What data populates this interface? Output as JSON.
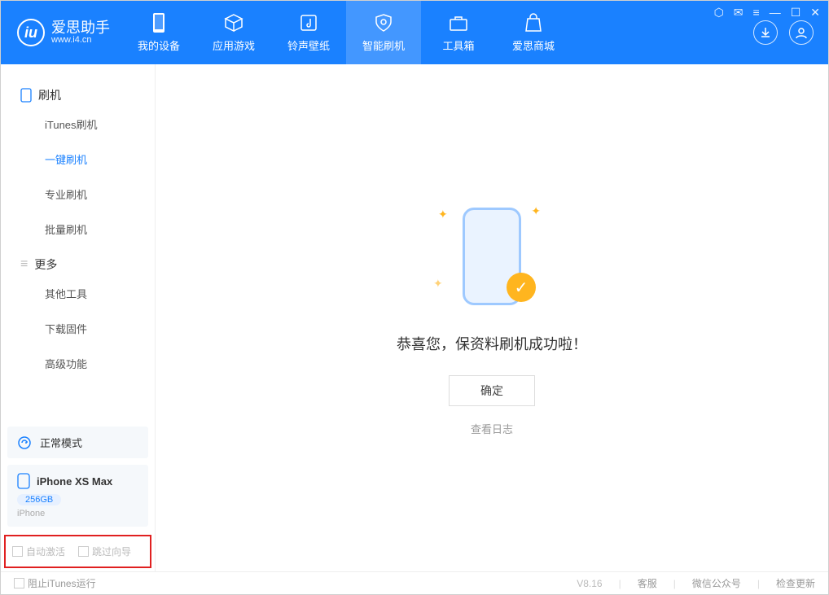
{
  "app": {
    "title": "爱思助手",
    "url": "www.i4.cn"
  },
  "nav": {
    "items": [
      {
        "label": "我的设备"
      },
      {
        "label": "应用游戏"
      },
      {
        "label": "铃声壁纸"
      },
      {
        "label": "智能刷机"
      },
      {
        "label": "工具箱"
      },
      {
        "label": "爱思商城"
      }
    ]
  },
  "sidebar": {
    "group1": "刷机",
    "items1": [
      "iTunes刷机",
      "一键刷机",
      "专业刷机",
      "批量刷机"
    ],
    "group2": "更多",
    "items2": [
      "其他工具",
      "下载固件",
      "高级功能"
    ],
    "status": "正常模式",
    "device": {
      "name": "iPhone XS Max",
      "capacity": "256GB",
      "type": "iPhone"
    },
    "redbox": {
      "opt1": "自动激活",
      "opt2": "跳过向导"
    }
  },
  "main": {
    "message": "恭喜您，保资料刷机成功啦！",
    "ok": "确定",
    "logs": "查看日志"
  },
  "footer": {
    "block_itunes": "阻止iTunes运行",
    "version": "V8.16",
    "links": [
      "客服",
      "微信公众号",
      "检查更新"
    ]
  }
}
